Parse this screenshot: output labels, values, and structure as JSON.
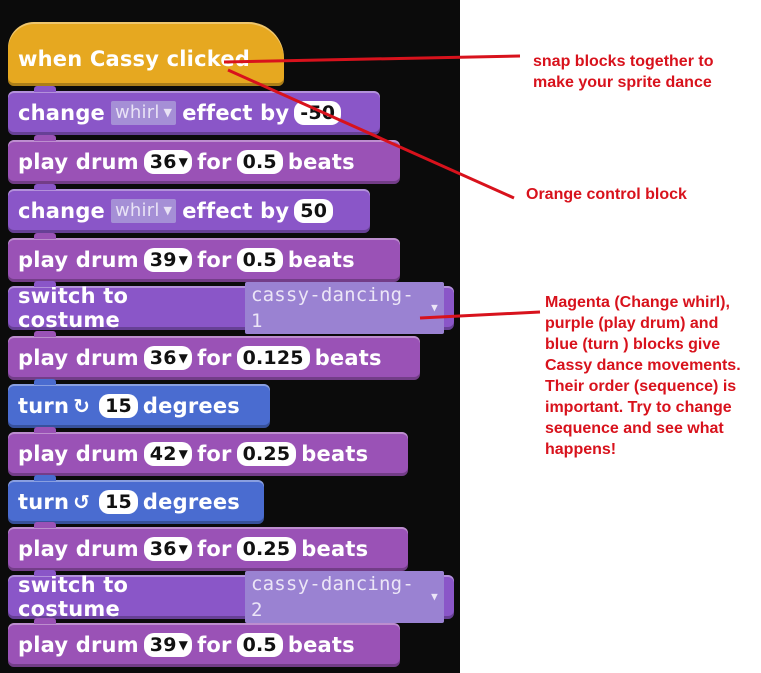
{
  "hat": {
    "label": "when Cassy clicked"
  },
  "blocks": {
    "b1": {
      "w1": "change",
      "menu": "whirl",
      "w2": "effect by",
      "val": "-50"
    },
    "b2": {
      "w1": "play drum",
      "drum": "36",
      "w2": "for",
      "beats": "0.5",
      "w3": "beats"
    },
    "b3": {
      "w1": "change",
      "menu": "whirl",
      "w2": "effect by",
      "val": "50"
    },
    "b4": {
      "w1": "play drum",
      "drum": "39",
      "w2": "for",
      "beats": "0.5",
      "w3": "beats"
    },
    "b5": {
      "w1": "switch to costume",
      "costume": "cassy-dancing-1"
    },
    "b6": {
      "w1": "play drum",
      "drum": "36",
      "w2": "for",
      "beats": "0.125",
      "w3": "beats"
    },
    "b7": {
      "w1": "turn",
      "deg": "15",
      "w2": "degrees"
    },
    "b8": {
      "w1": "play drum",
      "drum": "42",
      "w2": "for",
      "beats": "0.25",
      "w3": "beats"
    },
    "b9": {
      "w1": "turn",
      "deg": "15",
      "w2": "degrees"
    },
    "b10": {
      "w1": "play drum",
      "drum": "36",
      "w2": "for",
      "beats": "0.25",
      "w3": "beats"
    },
    "b11": {
      "w1": "switch to costume",
      "costume": "cassy-dancing-2"
    },
    "b12": {
      "w1": "play drum",
      "drum": "39",
      "w2": "for",
      "beats": "0.5",
      "w3": "beats"
    }
  },
  "notes": {
    "snap": [
      "snap blocks together to",
      "make your sprite dance"
    ],
    "orange": "Orange control block",
    "magenta": [
      "Magenta (Change whirl),",
      "purple (play drum) and",
      "blue (turn ) blocks give",
      "Cassy dance movements.",
      "Their order (sequence) is",
      "important. Try to change",
      "sequence and see what",
      "happens!"
    ]
  },
  "colors": {
    "annotation": "#d8121c",
    "control": "#e6a820",
    "sound": "#9a52b6",
    "looks": "#8a56c8",
    "motion": "#4a6cd0"
  },
  "icons": {
    "turn_right": "rotate-clockwise-icon",
    "turn_left": "rotate-counterclockwise-icon",
    "dropdown": "dropdown-arrow-icon"
  }
}
